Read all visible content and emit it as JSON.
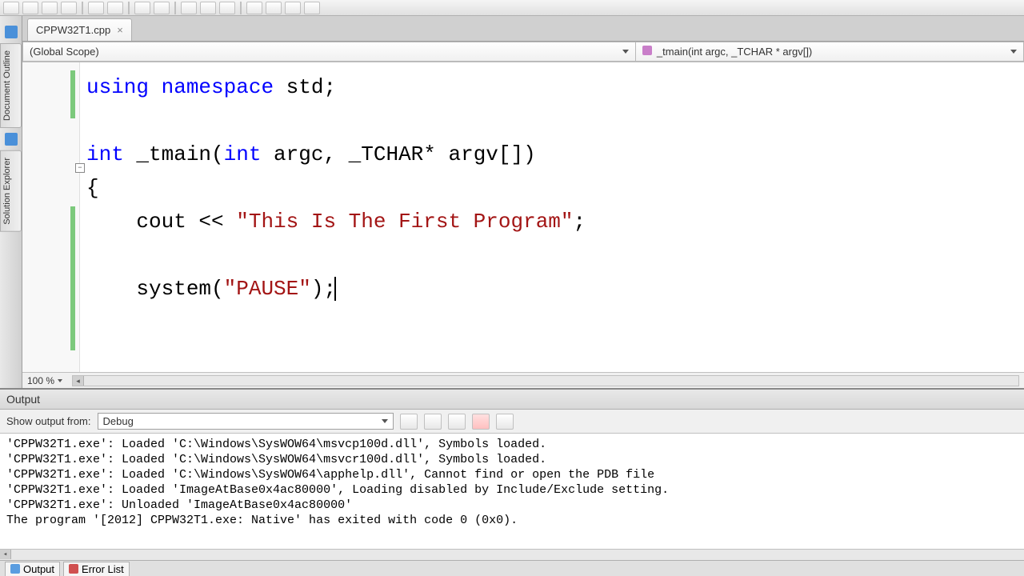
{
  "tab": {
    "filename": "CPPW32T1.cpp"
  },
  "dropdowns": {
    "scope": "(Global Scope)",
    "member": "_tmain(int argc, _TCHAR * argv[])"
  },
  "code": {
    "line1_kw1": "using",
    "line1_kw2": "namespace",
    "line1_rest": " std;",
    "line3_kw1": "int",
    "line3_txt1": " _tmain(",
    "line3_kw2": "int",
    "line3_txt2": " argc, _TCHAR* argv[])",
    "line4": "{",
    "line5_pre": "    cout << ",
    "line5_str": "\"This Is The First Program\"",
    "line5_post": ";",
    "line7_pre": "    system(",
    "line7_str": "\"PAUSE\"",
    "line7_post": ");"
  },
  "zoom": "100 %",
  "output": {
    "title": "Output",
    "show_label": "Show output from:",
    "source": "Debug",
    "lines": [
      "'CPPW32T1.exe': Loaded 'C:\\Windows\\SysWOW64\\msvcp100d.dll', Symbols loaded.",
      "'CPPW32T1.exe': Loaded 'C:\\Windows\\SysWOW64\\msvcr100d.dll', Symbols loaded.",
      "'CPPW32T1.exe': Loaded 'C:\\Windows\\SysWOW64\\apphelp.dll', Cannot find or open the PDB file",
      "'CPPW32T1.exe': Loaded 'ImageAtBase0x4ac80000', Loading disabled by Include/Exclude setting.",
      "'CPPW32T1.exe': Unloaded 'ImageAtBase0x4ac80000'",
      "The program '[2012] CPPW32T1.exe: Native' has exited with code 0 (0x0)."
    ]
  },
  "side_tabs": {
    "doc_outline": "Document Outline",
    "sol_explorer": "Solution Explorer"
  },
  "bottom_tabs": {
    "output": "Output",
    "error_list": "Error List"
  }
}
